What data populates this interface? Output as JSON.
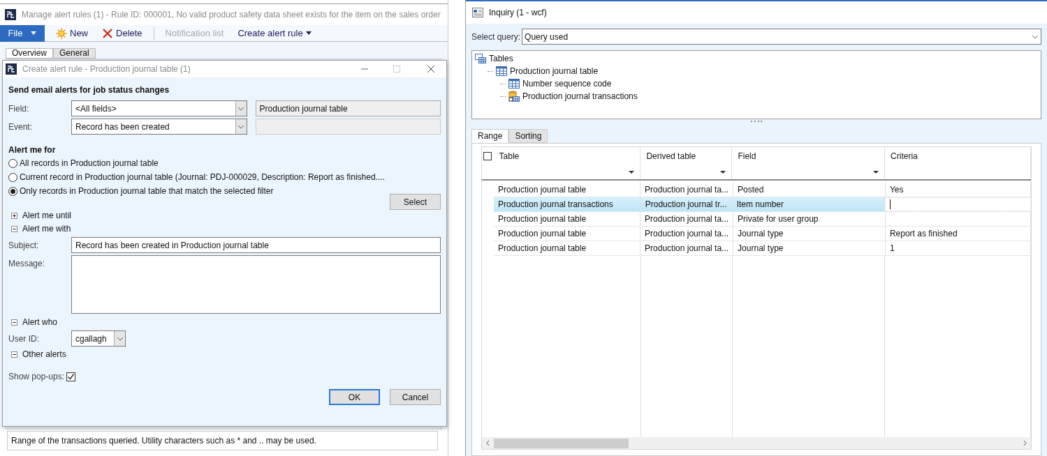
{
  "manage_window": {
    "title": "Manage alert rules (1) - Rule ID: 000001, No valid product safety data sheet exists for the item on the sales order",
    "file_button": "File",
    "actions": [
      {
        "kind": "new",
        "label": "New",
        "disabled": false
      },
      {
        "kind": "delete",
        "label": "Delete",
        "disabled": false
      },
      {
        "kind": "plain",
        "label": "Notification list",
        "disabled": true
      },
      {
        "kind": "menu",
        "label": "Create alert rule",
        "disabled": false
      }
    ],
    "tabs": [
      {
        "label": "Overview",
        "selected": true
      },
      {
        "label": "General",
        "selected": false
      }
    ],
    "status_bar": "Range of the transactions queried. Utility characters such as * and .. may be used."
  },
  "dialog": {
    "title": "Create alert rule - Production journal table (1)",
    "heading": "Send email alerts for job status changes",
    "field": {
      "label": "Field:",
      "value": "<All fields>",
      "table": "Production journal table"
    },
    "event": {
      "label": "Event:",
      "value": "Record has been created"
    },
    "alert_me_for": {
      "title": "Alert me for",
      "options": [
        {
          "label": "All records in Production journal table",
          "selected": false
        },
        {
          "label": "Current record in Production journal table (Journal: PDJ-000029, Description: Report as finished....",
          "selected": false
        },
        {
          "label": "Only records in Production journal table that match the selected filter",
          "selected": true
        }
      ],
      "select_button": "Select"
    },
    "alert_me_until": {
      "label": "Alert me until",
      "expanded": false
    },
    "alert_me_with": {
      "label": "Alert me with",
      "expanded": true
    },
    "subject": {
      "label": "Subject:",
      "value": "Record has been created in Production journal table"
    },
    "message": {
      "label": "Message:"
    },
    "alert_who": {
      "label": "Alert who",
      "expanded": true
    },
    "user_id": {
      "label": "User ID:",
      "value": "cgallagh"
    },
    "other_alerts": {
      "label": "Other alerts",
      "expanded": true
    },
    "show_popups": {
      "label": "Show pop-ups:",
      "checked": true
    },
    "buttons": [
      "OK",
      "Cancel"
    ]
  },
  "inquiry": {
    "title": "Inquiry (1 - wcf)",
    "select_query": {
      "label": "Select query:",
      "value": "Query used"
    },
    "tree": [
      {
        "label": "Tables",
        "kind": "root",
        "children": [
          {
            "label": "Production journal table",
            "kind": "table",
            "children": [
              {
                "label": "Number sequence code",
                "kind": "table"
              },
              {
                "label": "Production journal transactions",
                "kind": "linked"
              }
            ]
          }
        ]
      }
    ],
    "tabs": [
      {
        "label": "Range",
        "selected": true
      },
      {
        "label": "Sorting",
        "selected": false
      }
    ],
    "table": {
      "select_all": {
        "checked": false
      },
      "columns": [
        "Table",
        "Derived table",
        "Field",
        "Criteria"
      ],
      "rows": [
        {
          "cells": [
            "Production journal table",
            "Production journal ta...",
            "Posted",
            "Yes"
          ],
          "selected": false
        },
        {
          "cells": [
            "Production journal transactions",
            "Production journal tr...",
            "Item number",
            ""
          ],
          "selected": true
        },
        {
          "cells": [
            "Production journal table",
            "Production journal ta...",
            "Private for user group",
            ""
          ],
          "selected": false
        },
        {
          "cells": [
            "Production journal table",
            "Production journal ta...",
            "Journal type",
            "Report as finished"
          ],
          "selected": false
        },
        {
          "cells": [
            "Production journal table",
            "Production journal ta...",
            "Journal type",
            "1"
          ],
          "selected": false
        }
      ]
    }
  }
}
